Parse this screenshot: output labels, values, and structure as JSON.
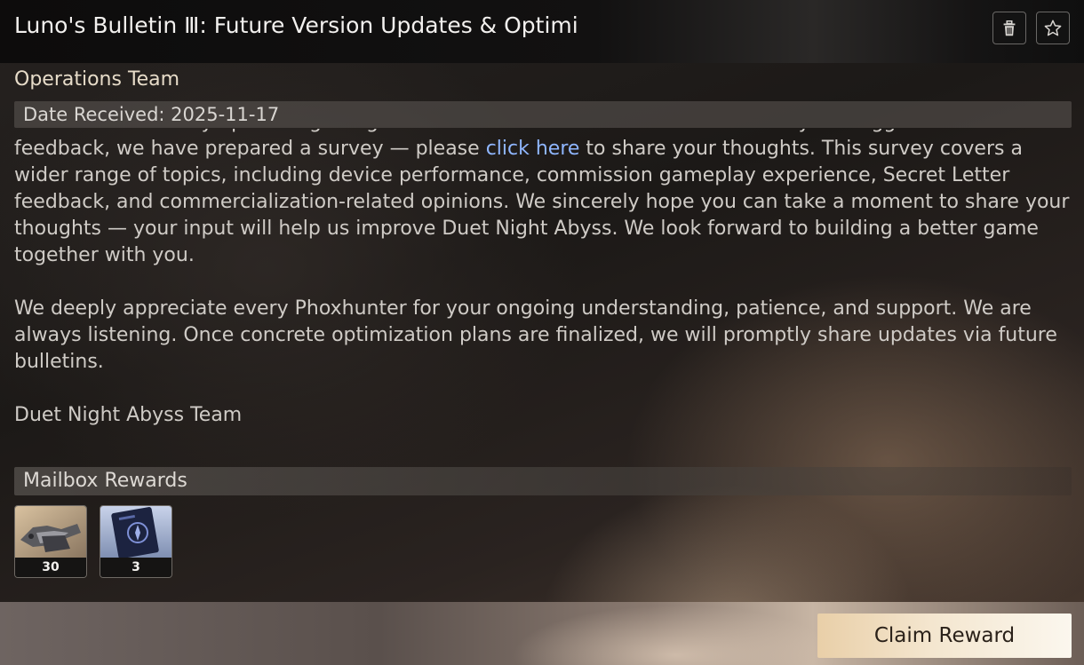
{
  "mail": {
    "title": "Luno's Bulletin Ⅲ: Future Version Updates & Optimi",
    "sender": "Operations Team",
    "date_label": "Date Received: 2025-11-17",
    "paragraph1_pre": "We are continuously optimizing the global launch version. To better understand your suggestions and feedback, we have prepared a survey — please ",
    "paragraph1_link": "click here",
    "paragraph1_post": " to share your thoughts. This survey covers a wider range of topics, including device performance, commission gameplay experience, Secret Letter feedback, and commercialization-related opinions. We sincerely hope you can take a moment to share your thoughts — your input will help us improve Duet Night Abyss. We look forward to building a better game together with you.",
    "paragraph2": "We deeply appreciate every Phoxhunter for your ongoing understanding, patience, and support. We are always listening. Once concrete optimization plans are finalized, we will promptly share updates via future bulletins.",
    "signature": "Duet Night Abyss Team"
  },
  "rewards": {
    "header": "Mailbox Rewards",
    "items": [
      {
        "icon": "gear-material-icon",
        "quantity": "30"
      },
      {
        "icon": "ticket-card-icon",
        "quantity": "3"
      }
    ]
  },
  "actions": {
    "claim_label": "Claim Reward"
  },
  "icons": {
    "delete": "trash-icon",
    "favorite": "star-icon"
  },
  "colors": {
    "link": "#8fb6ff",
    "claim_button": "#f4e6cf"
  }
}
